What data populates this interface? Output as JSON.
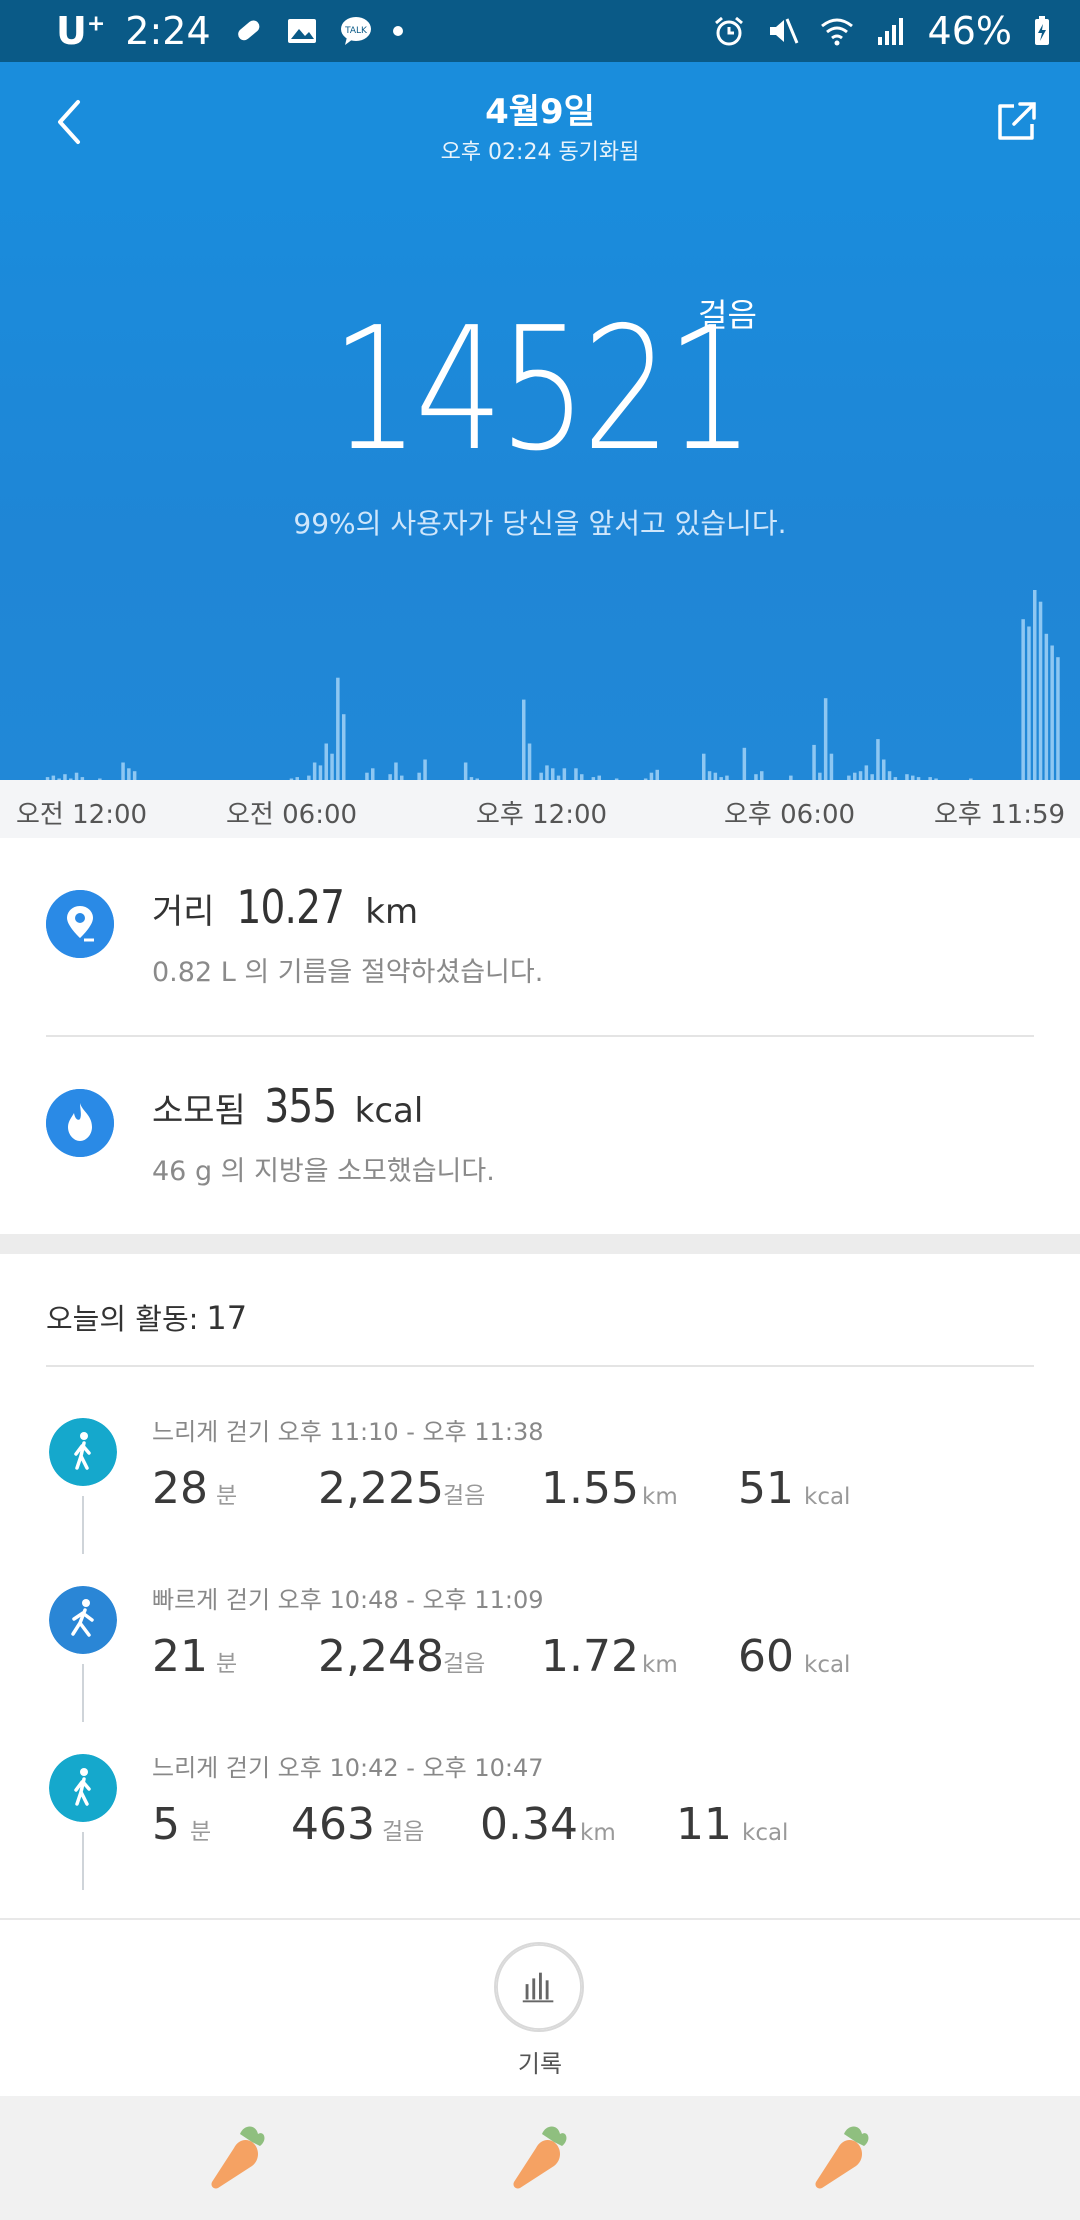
{
  "status_bar": {
    "carrier": "U",
    "carrier_sup": "+",
    "time": "2:24",
    "battery": "46%"
  },
  "header": {
    "title": "4월9일",
    "subtitle": "오후 02:24 동기화됨"
  },
  "hero": {
    "steps": "14521",
    "steps_unit": "걸음",
    "rank_text": "99%의 사용자가 당신을 앞서고 있습니다."
  },
  "chart_data": {
    "type": "bar",
    "title": "",
    "x_ticks": [
      "오전 12:00",
      "오전 06:00",
      "오후 12:00",
      "오후 06:00",
      "오후 11:59"
    ],
    "values": [
      0,
      2,
      3,
      1,
      4,
      1,
      5,
      2,
      0,
      0,
      1,
      0,
      0,
      0,
      12,
      8,
      6,
      0,
      0,
      0,
      0,
      0,
      0,
      0,
      0,
      0,
      0,
      0,
      0,
      0,
      0,
      0,
      0,
      0,
      0,
      0,
      0,
      0,
      0,
      0,
      0,
      0,
      0,
      1,
      2,
      0,
      3,
      12,
      10,
      25,
      18,
      70,
      45,
      0,
      0,
      0,
      5,
      8,
      0,
      0,
      4,
      12,
      3,
      0,
      0,
      5,
      14,
      0,
      0,
      0,
      0,
      0,
      0,
      12,
      2,
      1,
      0,
      0,
      0,
      0,
      0,
      0,
      0,
      55,
      25,
      0,
      5,
      10,
      8,
      3,
      8,
      0,
      8,
      4,
      0,
      2,
      3,
      0,
      0,
      1,
      0,
      0,
      0,
      0,
      1,
      5,
      7,
      0,
      0,
      0,
      0,
      0,
      0,
      0,
      18,
      6,
      5,
      2,
      3,
      0,
      0,
      22,
      0,
      4,
      6,
      0,
      0,
      0,
      0,
      3,
      0,
      0,
      0,
      24,
      5,
      56,
      18,
      0,
      0,
      3,
      5,
      6,
      10,
      4,
      28,
      14,
      6,
      2,
      0,
      4,
      3,
      2,
      0,
      2,
      1,
      0,
      0,
      0,
      0,
      0,
      1,
      0,
      0,
      0,
      0,
      0,
      0,
      0,
      0,
      110,
      105,
      130,
      122,
      100,
      92,
      84
    ]
  },
  "axis": [
    "오전 12:00",
    "오전 06:00",
    "오후 12:00",
    "오후 06:00",
    "오후 11:59"
  ],
  "distance": {
    "label": "거리",
    "value": "10.27",
    "unit": "km",
    "note": "0.82 L 의 기름을 절약하셨습니다."
  },
  "calories": {
    "label": "소모됨",
    "value": "355",
    "unit": "kcal",
    "note": "46 g 의 지방을 소모했습니다."
  },
  "activities": {
    "title": "오늘의 활동:",
    "count": "17",
    "items": [
      {
        "type": "느리게 걷기",
        "time": "느리게 걷기 오후 11:10 - 오후 11:38",
        "minutes": "28",
        "min_unit": "분",
        "steps": "2,225",
        "steps_unit": "걸음",
        "km": "1.55",
        "km_unit": "km",
        "kcal": "51",
        "kcal_unit": "kcal",
        "color": "#15a8cc"
      },
      {
        "type": "빠르게 걷기",
        "time": "빠르게 걷기 오후 10:48 - 오후 11:09",
        "minutes": "21",
        "min_unit": "분",
        "steps": "2,248",
        "steps_unit": "걸음",
        "km": "1.72",
        "km_unit": "km",
        "kcal": "60",
        "kcal_unit": "kcal",
        "color": "#2a86d6"
      },
      {
        "type": "느리게 걷기",
        "time": "느리게 걷기 오후 10:42 - 오후 10:47",
        "minutes": "5",
        "min_unit": "분",
        "steps": "463",
        "steps_unit": "걸음",
        "km": "0.34",
        "km_unit": "km",
        "kcal": "11",
        "kcal_unit": "kcal",
        "color": "#15a8cc"
      }
    ]
  },
  "bottom": {
    "record_label": "기록"
  },
  "colors": {
    "status": "#0a5a87",
    "header": "#1a8ddc",
    "accent": "#2a8ae6"
  }
}
